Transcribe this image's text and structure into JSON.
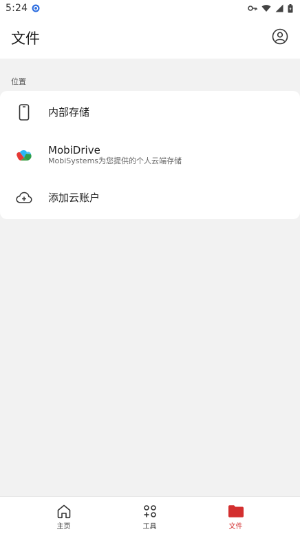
{
  "status_bar": {
    "time": "5:24",
    "icons": [
      "notification-app-icon",
      "key-icon",
      "wifi-icon",
      "signal-icon",
      "battery-icon"
    ]
  },
  "app_bar": {
    "title": "文件",
    "account_icon": "account-circle-icon"
  },
  "locations": {
    "section_label": "位置",
    "items": [
      {
        "title": "内部存储",
        "subtitle": "",
        "icon": "phone-icon"
      },
      {
        "title": "MobiDrive",
        "subtitle": "MobiSystems为您提供的个人云端存储",
        "icon": "mobidrive-logo-icon"
      },
      {
        "title": "添加云账户",
        "subtitle": "",
        "icon": "cloud-add-icon"
      }
    ]
  },
  "bottom_nav": {
    "items": [
      {
        "label": "主页",
        "icon": "home-icon",
        "active": false
      },
      {
        "label": "工具",
        "icon": "tools-icon",
        "active": false
      },
      {
        "label": "文件",
        "icon": "folder-icon",
        "active": true
      }
    ]
  },
  "colors": {
    "accent": "#d32f2f",
    "background": "#f2f2f2",
    "surface": "#ffffff"
  }
}
